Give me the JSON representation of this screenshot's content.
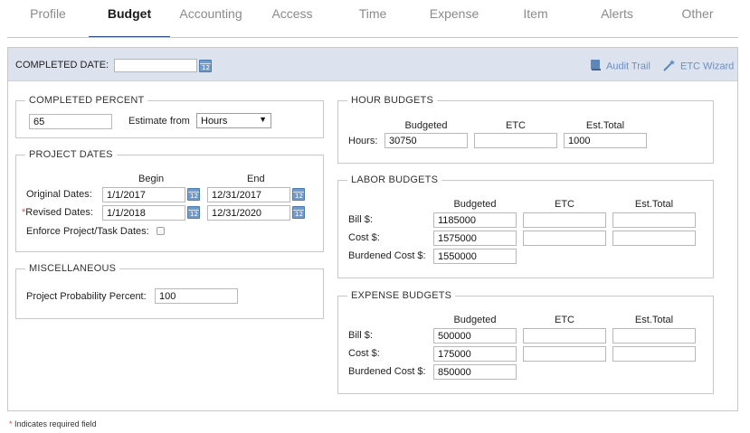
{
  "tabs": [
    {
      "label": "Profile"
    },
    {
      "label": "Budget",
      "active": true
    },
    {
      "label": "Accounting"
    },
    {
      "label": "Access"
    },
    {
      "label": "Time"
    },
    {
      "label": "Expense"
    },
    {
      "label": "Item"
    },
    {
      "label": "Alerts"
    },
    {
      "label": "Other"
    }
  ],
  "header": {
    "completed_date_label": "COMPLETED DATE:",
    "completed_date_value": "",
    "audit_trail": "Audit Trail",
    "etc_wizard": "ETC Wizard",
    "link_color": "#6b8fc0"
  },
  "completed_percent": {
    "legend": "COMPLETED PERCENT",
    "value": "65",
    "estimate_from_label": "Estimate from",
    "estimate_from_value": "Hours"
  },
  "project_dates": {
    "legend": "PROJECT DATES",
    "begin_header": "Begin",
    "end_header": "End",
    "original_label": "Original Dates:",
    "original_begin": "1/1/2017",
    "original_end": "12/31/2017",
    "revised_required": "*",
    "revised_label": "Revised Dates:",
    "revised_begin": "1/1/2018",
    "revised_end": "12/31/2020",
    "enforce_label": "Enforce Project/Task Dates:"
  },
  "misc": {
    "legend": "MISCELLANEOUS",
    "probability_label": "Project Probability Percent:",
    "probability_value": "100"
  },
  "hour_budgets": {
    "legend": "HOUR BUDGETS",
    "col_budgeted": "Budgeted",
    "col_etc": "ETC",
    "col_est_total": "Est.Total",
    "hours_label": "Hours:",
    "hours_budgeted": "30750",
    "hours_etc": "",
    "hours_est_total": "1000"
  },
  "labor_budgets": {
    "legend": "LABOR BUDGETS",
    "col_budgeted": "Budgeted",
    "col_etc": "ETC",
    "col_est_total": "Est.Total",
    "bill_label": "Bill $:",
    "bill_budgeted": "1185000",
    "cost_label": "Cost $:",
    "cost_budgeted": "1575000",
    "burdened_label": "Burdened Cost $:",
    "burdened_budgeted": "1550000"
  },
  "expense_budgets": {
    "legend": "EXPENSE BUDGETS",
    "col_budgeted": "Budgeted",
    "col_etc": "ETC",
    "col_est_total": "Est.Total",
    "bill_label": "Bill $:",
    "bill_budgeted": "500000",
    "cost_label": "Cost $:",
    "cost_budgeted": "175000",
    "burdened_label": "Burdened Cost $:",
    "burdened_budgeted": "850000"
  },
  "footer": {
    "required_marker": "*",
    "required_note": "Indicates required field"
  }
}
